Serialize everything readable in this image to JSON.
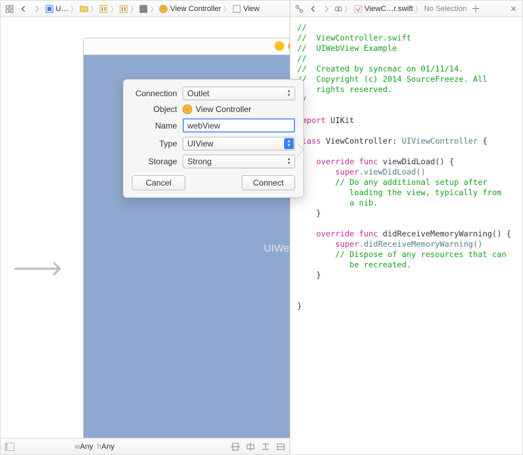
{
  "left_breadcrumb": {
    "items": [
      {
        "label": "U…"
      },
      {
        "label": ""
      },
      {
        "label": ""
      },
      {
        "label": ""
      },
      {
        "label": ""
      },
      {
        "label": "View Controller"
      },
      {
        "label": "View"
      }
    ]
  },
  "right_breadcrumb": {
    "file": "ViewC…r.swift",
    "selection": "No Selection"
  },
  "ib": {
    "webview_label": "UIWeb"
  },
  "popover": {
    "labels": {
      "connection": "Connection",
      "object": "Object",
      "name": "Name",
      "type": "Type",
      "storage": "Storage"
    },
    "connection_value": "Outlet",
    "object_value": "View Controller",
    "name_value": "webView",
    "type_value": "UIView",
    "storage_value": "Strong",
    "cancel": "Cancel",
    "connect": "Connect"
  },
  "bottom": {
    "size_w_prefix": "w",
    "size_w": "Any",
    "size_h_prefix": "h",
    "size_h": "Any"
  },
  "code": {
    "l1": "//",
    "l2": "//  ViewController.swift",
    "l3": "//  UIWebView Example",
    "l4": "//",
    "l5": "//  Created by syncmac on 01/11/14.",
    "l6": "//  Copyright (c) 2014 SourceFreeze. All",
    "l6b": "    rights reserved.",
    "l7": "//",
    "kw_import": "import",
    "uikit": "UIKit",
    "kw_class": "class",
    "cls_name": "ViewController",
    "colon": ":",
    "supercls": "UIViewController",
    "brace_o": " {",
    "ovr": "override",
    "func": "func",
    "vdl": "viewDidLoad",
    "paren": "() {",
    "super": "super",
    "dot_vdl": ".viewDidLoad()",
    "cmt1a": "// Do any additional setup after",
    "cmt1b": "   loading the view, typically from",
    "cmt1c": "   a nib.",
    "brace_c": "}",
    "drmw": "didReceiveMemoryWarning",
    "dot_drmw": ".didReceiveMemoryWarning()",
    "cmt2a": "// Dispose of any resources that can",
    "cmt2b": "   be recreated."
  }
}
